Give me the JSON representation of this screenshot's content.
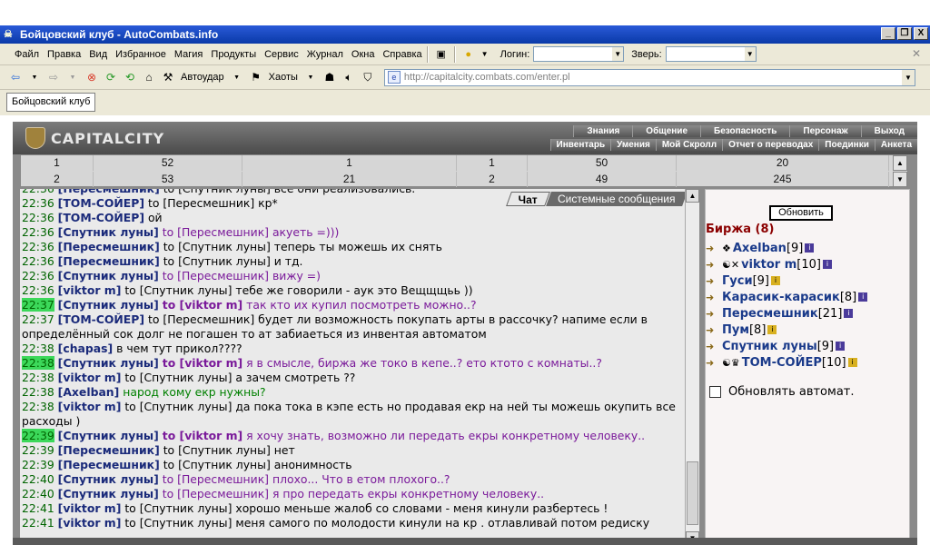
{
  "window": {
    "title": "Бойцовский клуб - AutoCombats.info",
    "min": "_",
    "max": "❐",
    "close": "X"
  },
  "menu": [
    "Файл",
    "Правка",
    "Вид",
    "Избранное",
    "Магия",
    "Продукты",
    "Сервис",
    "Журнал",
    "Окна",
    "Справка"
  ],
  "login_label": "Логин:",
  "beast_label": "Зверь:",
  "toolbar": {
    "autoudar": "Автоудар",
    "haoty": "Хаоты"
  },
  "address": "http://capitalcity.combats.com/enter.pl",
  "page_tab": "Бойцовский клуб",
  "game": {
    "logo": "CAPITALCITY",
    "nav_top": [
      "Знания",
      "Общение",
      "Безопасность",
      "Персонаж",
      "Выход"
    ],
    "nav_bottom": [
      "Инвентарь",
      "Умения",
      "Мой Скролл",
      "Отчет о переводах",
      "Поединки",
      "Анкета"
    ]
  },
  "stats": {
    "row1": [
      "1",
      "52",
      "1",
      "1",
      "50",
      "20"
    ],
    "row2": [
      "2",
      "53",
      "21",
      "2",
      "49",
      "245"
    ]
  },
  "chat_tabs": {
    "chat": "Чат",
    "system": "Системные сообщения"
  },
  "chat": [
    {
      "t": "22:36",
      "from": "Пересмешник",
      "to": "Спутник луны",
      "msg": "все они реализовались."
    },
    {
      "t": "22:36",
      "from": "ТОМ-СОЙЕР",
      "to": "Пересмешник",
      "msg": "кр*"
    },
    {
      "t": "22:36",
      "from": "ТОМ-СОЙЕР",
      "msg": "ой"
    },
    {
      "t": "22:36",
      "from": "Спутник луны",
      "to": "Пересмешник",
      "msg": "акуеть =)))"
    },
    {
      "t": "22:36",
      "from": "Пересмешник",
      "to": "Спутник луны",
      "msg": "теперь ты можешь их снять"
    },
    {
      "t": "22:36",
      "from": "Пересмешник",
      "to": "Спутник луны",
      "msg": "и тд."
    },
    {
      "t": "22:36",
      "from": "Спутник луны",
      "to": "Пересмешник",
      "msg": "вижу =)"
    },
    {
      "t": "22:36",
      "from": "viktor m",
      "to": "Спутник луны",
      "msg": "тебе же говорили - аук это Вещщщьь ))"
    },
    {
      "t": "22:37",
      "from": "Спутник луны",
      "to": "viktor m",
      "msg": "так кто их купил посмотреть можно..?"
    },
    {
      "t": "22:37",
      "from": "ТОМ-СОЙЕР",
      "to": "Пересмешник",
      "msg": "будет ли возможность покупать арты в рассочку? напиме если в определённый сок долг не погашен то ат забиаеться из инвентая автоматом"
    },
    {
      "t": "22:38",
      "from": "chapas",
      "msg": "в чем тут прикол????"
    },
    {
      "t": "22:38",
      "from": "Спутник луны",
      "to": "viktor m",
      "msg": "я в смысле, биржа же токо в кепе..? ето ктото с комнаты..?"
    },
    {
      "t": "22:38",
      "from": "viktor m",
      "to": "Спутник луны",
      "msg": "а зачем смотреть ??"
    },
    {
      "t": "22:38",
      "from": "Axelban",
      "msg": "народ кому екр нужны?"
    },
    {
      "t": "22:38",
      "from": "viktor m",
      "to": "Спутник луны",
      "msg": "да пока тока в кэпе есть но продавая екр на ней ты можешь окупить все расходы )"
    },
    {
      "t": "22:39",
      "from": "Спутник луны",
      "to": "viktor m",
      "msg": "я хочу знать, возможно ли передать екры конкретному человеку.."
    },
    {
      "t": "22:39",
      "from": "Пересмешник",
      "to": "Спутник луны",
      "msg": "нет"
    },
    {
      "t": "22:39",
      "from": "Пересмешник",
      "to": "Спутник луны",
      "msg": "анонимность"
    },
    {
      "t": "22:40",
      "from": "Спутник луны",
      "to": "Пересмешник",
      "msg": "плохо... Что в етом плохого..?"
    },
    {
      "t": "22:40",
      "from": "Спутник луны",
      "to": "Пересмешник",
      "msg": "я про передать екры конкретному человеку.."
    },
    {
      "t": "22:41",
      "from": "viktor m",
      "to": "Спутник луны",
      "msg": "хорошо меньше жалоб со словами - меня кинули разбертесь !"
    },
    {
      "t": "22:41",
      "from": "viktor m",
      "to": "Спутник луны",
      "msg": "меня самого по молодости кинули на кр . отлавливай потом редиску"
    }
  ],
  "side": {
    "refresh": "Обновить",
    "birzha": "Биржа (8)",
    "users": [
      {
        "name": "Axelban",
        "level": "[9]"
      },
      {
        "name": "viktor m",
        "level": "[10]"
      },
      {
        "name": "Гуси",
        "level": "[9]"
      },
      {
        "name": "Карасик-карасик",
        "level": "[8]"
      },
      {
        "name": "Пересмешник",
        "level": "[21]"
      },
      {
        "name": "Пум",
        "level": "[8]"
      },
      {
        "name": "Спутник луны",
        "level": "[9]"
      },
      {
        "name": "ТОМ-СОЙЕР",
        "level": "[10]"
      }
    ],
    "auto": "Обновлять автомат."
  },
  "colors": {
    "titlebar": "#0a3aa8",
    "chat_bg": "#eaeaea",
    "time": "#006400",
    "private": "#7a1a9a",
    "nick": "#1a2a7a"
  }
}
